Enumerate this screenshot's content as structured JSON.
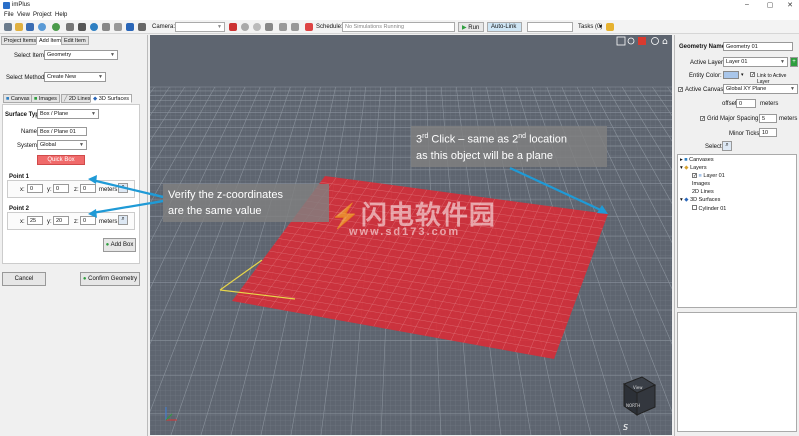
{
  "window": {
    "title": "imPlus",
    "controls": {
      "minimize": "–",
      "maximize": "▢",
      "close": "✕"
    }
  },
  "menu": [
    "File",
    "View",
    "Project",
    "Help"
  ],
  "toolbar": {
    "camera_label": "Camera:",
    "schedule_label": "Schedule:",
    "schedule_placeholder": "No Simulations Running",
    "run_label": "Run",
    "autolink_label": "Auto-Link",
    "tasks_label": "Tasks (0)"
  },
  "left_panel": {
    "top_tabs": [
      "Project Items",
      "Add Item",
      "Edit Item"
    ],
    "select_item_label": "Select Item:",
    "select_item_value": "Geometry",
    "select_method_label": "Select Method:",
    "select_method_value": "Create New",
    "sub_tabs": [
      "Canvas",
      "Images",
      "2D Lines",
      "3D Surfaces"
    ],
    "surface_type_label": "Surface Type:",
    "surface_type_value": "Box / Plane",
    "name_label": "Name:",
    "name_value": "Box / Plane 01",
    "system_label": "System:",
    "system_value": "Global",
    "quick_box_label": "Quick Box",
    "point1": {
      "title": "Point 1",
      "x": "0",
      "y": "0",
      "z": "0",
      "unit": "meters"
    },
    "point2": {
      "title": "Point 2",
      "x": "25",
      "y": "20",
      "z": "0",
      "unit": "meters"
    },
    "add_box_label": "Add Box",
    "cancel_label": "Cancel",
    "confirm_label": "Confirm Geometry"
  },
  "right_panel": {
    "geometry_name_label": "Geometry Name:",
    "geometry_name_value": "Geometry 01",
    "active_layer_label": "Active Layer:",
    "active_layer_value": "Layer 01",
    "entity_color_label": "Entity Color:",
    "link_active_layer_label": "Link to Active Layer",
    "active_canvas_label": "Active Canvas:",
    "active_canvas_value": "Global XY Plane",
    "offset_label": "offset:",
    "offset_value": "0",
    "offset_unit": "meters",
    "grid_label": "Grid",
    "major_spacing_label": "Major Spacing:",
    "major_spacing_value": "5",
    "major_spacing_unit": "meters",
    "minor_ticks_label": "Minor Ticks:",
    "minor_ticks_value": "10",
    "select_label": "Select:",
    "tree": {
      "canvases": "Canvases",
      "layers": "Layers",
      "layer01": "Layer 01",
      "images": "Images",
      "lines2d": "2D Lines",
      "surfaces3d": "3D Surfaces",
      "cylinder01": "Cylinder 01"
    }
  },
  "viewport": {
    "view_cube_top": "View",
    "view_cube_front": "NORTH",
    "compass_letter": "S"
  },
  "annotations": {
    "third_click_line1_pre": "3",
    "third_click_sup1": "rd",
    "third_click_line1_mid": " Click – same as 2",
    "third_click_sup2": "nd",
    "third_click_line1_post": " location",
    "third_click_line2": "as this object will be a plane",
    "verify_line1": "Verify the z-coordinates",
    "verify_line2": "are the same value"
  },
  "watermark": {
    "text": "闪电软件园",
    "url": "www.sd173.com"
  },
  "colors": {
    "plane": "#d92b35",
    "accent_blue": "#1f9ad6",
    "quick_box": "#f06a6a",
    "viewport_bg": "#5e6570",
    "confirm_green": "#2e9e3e"
  }
}
